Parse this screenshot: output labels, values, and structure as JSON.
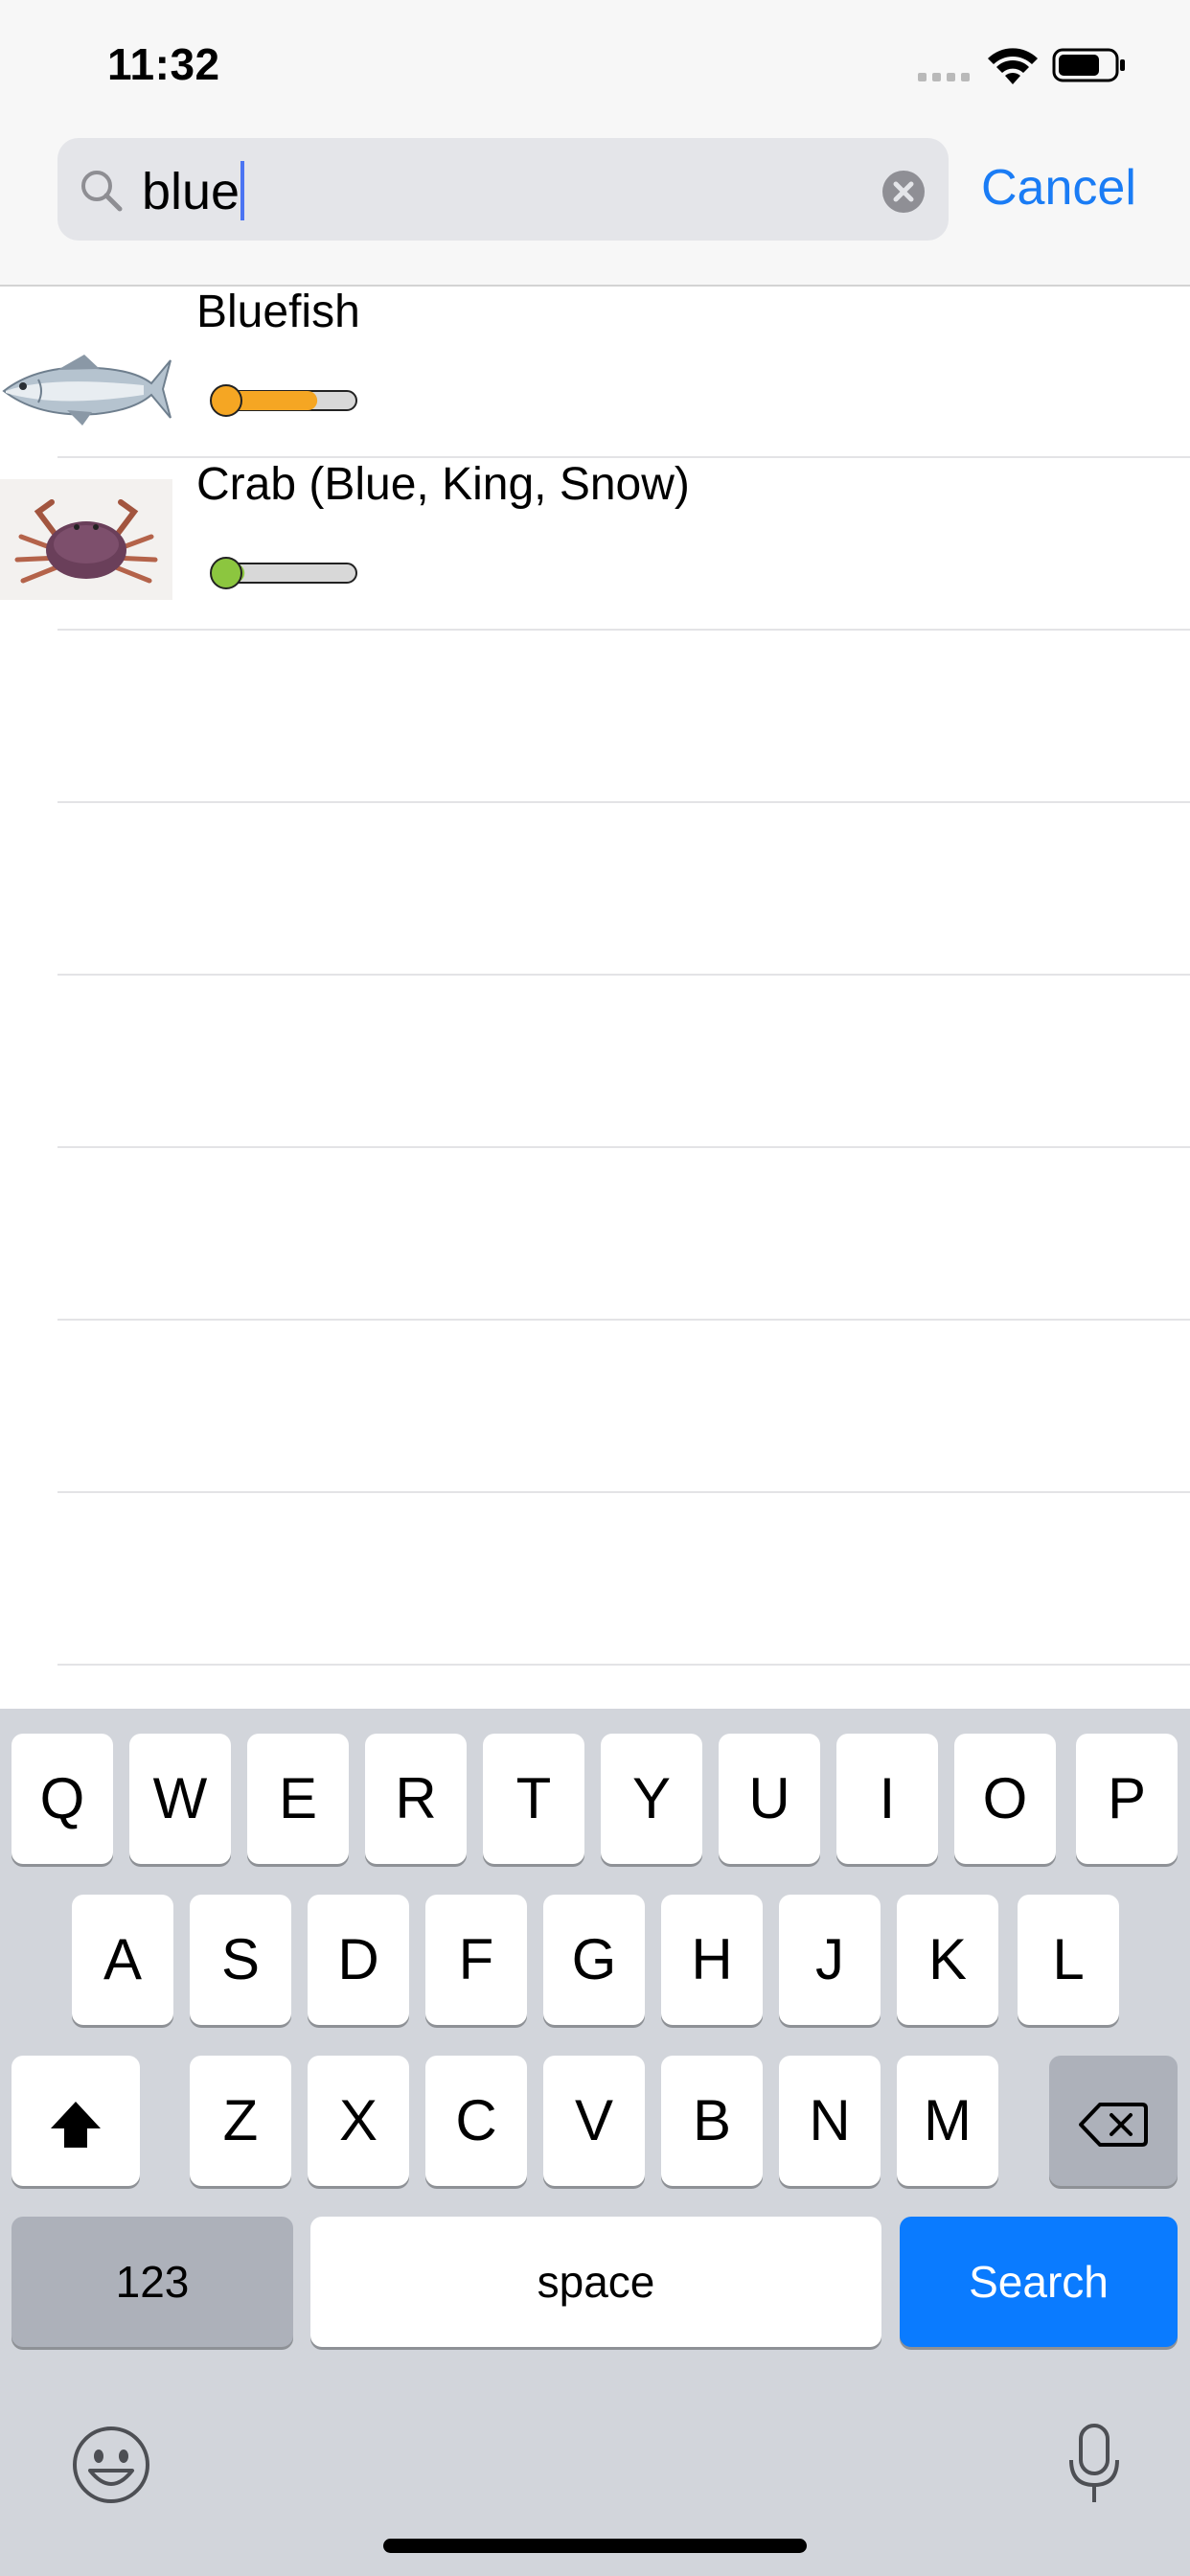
{
  "status_bar": {
    "time": "11:32"
  },
  "search": {
    "query": "blue",
    "cancel_label": "Cancel"
  },
  "results": [
    {
      "name": "Bluefish",
      "image": "bluefish-photo",
      "meter_level": 0.72,
      "meter_color": "#f5a623"
    },
    {
      "name": "Crab (Blue, King, Snow)",
      "image": "crab-photo",
      "meter_level": 0.2,
      "meter_color": "#8cc63f"
    }
  ],
  "keyboard": {
    "row1": [
      "Q",
      "W",
      "E",
      "R",
      "T",
      "Y",
      "U",
      "I",
      "O",
      "P"
    ],
    "row2": [
      "A",
      "S",
      "D",
      "F",
      "G",
      "H",
      "J",
      "K",
      "L"
    ],
    "row3": [
      "Z",
      "X",
      "C",
      "V",
      "B",
      "N",
      "M"
    ],
    "numbers_label": "123",
    "space_label": "space",
    "search_label": "Search"
  },
  "colors": {
    "accent": "#1a7cf5",
    "search_key": "#0a7bff",
    "keyboard_bg": "#d2d5db"
  },
  "icons": [
    "search-icon",
    "clear-icon",
    "wifi-icon",
    "battery-icon",
    "shift-icon",
    "delete-icon",
    "emoji-icon",
    "microphone-icon"
  ]
}
